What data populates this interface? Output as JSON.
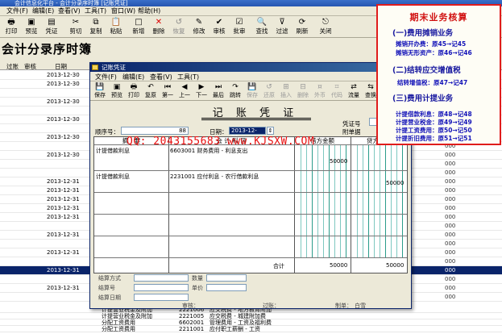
{
  "main": {
    "title": "会计信息化平台 - 会计分录序时簿 [记账凭证]",
    "menu": [
      "文件(F)",
      "编辑(E)",
      "查看(V)",
      "工具(T)",
      "窗口(W)",
      "帮助(H)"
    ],
    "toolbar": [
      "打印",
      "预览",
      "凭证",
      "剪切",
      "复制",
      "粘贴",
      "新增",
      "删除",
      "恢复",
      "修改",
      "审核",
      "批审",
      "查找",
      "过滤",
      "刷新",
      "关闭"
    ],
    "heading": "会计分录序时簿",
    "grid_headers": [
      "过账",
      "审核",
      "日期"
    ],
    "rows": [
      {
        "date": "2013-12-30",
        "amt": "000"
      },
      {
        "date": "2013-12-30",
        "amt": "000"
      },
      {
        "date": "",
        "amt": "000"
      },
      {
        "date": "2013-12-30",
        "amt": "000"
      },
      {
        "date": "",
        "amt": "000"
      },
      {
        "date": "2013-12-30",
        "amt": "000"
      },
      {
        "date": "",
        "amt": "000"
      },
      {
        "date": "2013-12-30",
        "amt": "000"
      },
      {
        "date": "",
        "amt": "000"
      },
      {
        "date": "2013-12-30",
        "amt": "000"
      },
      {
        "date": "",
        "amt": "000"
      },
      {
        "date": "",
        "amt": "000"
      },
      {
        "date": "2013-12-31",
        "amt": "000"
      },
      {
        "date": "2013-12-31",
        "amt": "000"
      },
      {
        "date": "2013-12-31",
        "amt": "000"
      },
      {
        "date": "2013-12-31",
        "amt": "000"
      },
      {
        "date": "2013-12-31",
        "amt": "000"
      },
      {
        "date": "",
        "amt": "000"
      },
      {
        "date": "2013-12-31",
        "amt": "000"
      },
      {
        "date": "",
        "amt": "000"
      },
      {
        "date": "2013-12-31",
        "amt": "000"
      },
      {
        "date": "",
        "amt": "000"
      },
      {
        "date": "2013-12-31",
        "amt": "000"
      },
      {
        "date": "",
        "amt": "000"
      },
      {
        "date": "2013-12-31",
        "amt": "000"
      },
      {
        "date": "",
        "amt": "000"
      }
    ],
    "bottom_rows": [
      {
        "desc": "计提营业税金及附加",
        "code": "2221006",
        "acct": "应交税费 - 地方教育附加"
      },
      {
        "desc": "计提营业税金及附加",
        "code": "2221005",
        "acct": "应交税费 - 城建附加费"
      },
      {
        "desc": "分配工资费用",
        "code": "6602001",
        "acct": "管理费用 - 工资及福利费"
      },
      {
        "desc": "分配工资费用",
        "code": "2211001",
        "acct": "应付职工薪酬 - 工资"
      }
    ]
  },
  "dialog": {
    "title": "记账凭证",
    "menu": [
      "文件(F)",
      "编辑(E)",
      "查看(V)",
      "工具(T)"
    ],
    "toolbar": [
      {
        "label": "保存",
        "icon": "floppy",
        "disabled": false
      },
      {
        "label": "预览",
        "icon": "preview",
        "disabled": false
      },
      {
        "label": "打印",
        "icon": "printer",
        "disabled": false
      },
      {
        "label": "复原",
        "icon": "undo",
        "disabled": false
      },
      {
        "label": "第一",
        "icon": "first",
        "disabled": false
      },
      {
        "label": "上一",
        "icon": "prev",
        "disabled": false
      },
      {
        "label": "下一",
        "icon": "next",
        "disabled": false
      },
      {
        "label": "最后",
        "icon": "last",
        "disabled": false
      },
      {
        "label": "跳转",
        "icon": "jump",
        "disabled": false
      },
      {
        "label": "保存",
        "icon": "save2",
        "disabled": true
      },
      {
        "label": "还原",
        "icon": "restore",
        "disabled": true
      },
      {
        "label": "插入",
        "icon": "insert",
        "disabled": true
      },
      {
        "label": "删除",
        "icon": "delete",
        "disabled": true
      },
      {
        "label": "外币",
        "icon": "currency",
        "disabled": true
      },
      {
        "label": "代码",
        "icon": "code",
        "disabled": true
      },
      {
        "label": "流量",
        "icon": "flow",
        "disabled": false
      },
      {
        "label": "查换",
        "icon": "swap",
        "disabled": false
      },
      {
        "label": "计算器",
        "icon": "calculator",
        "disabled": false
      }
    ],
    "voucher_title": "记 账 凭 证",
    "seq_label": "顺序号：",
    "seq_value": "88",
    "date_label": "日期：",
    "date_value": "2013-12-31",
    "voucher_no_label": "凭证号",
    "attach_label": "附单据",
    "col_summary": "摘　要",
    "col_account": "会 计 科 目",
    "col_debit": "借方金额",
    "col_credit": "贷方金额",
    "lines": [
      {
        "summary": "计提借款利息",
        "account": "6603001 财务费用 - 利息支出",
        "debit": "50000",
        "credit": ""
      },
      {
        "summary": "计提借款利息",
        "account": "2231001 应付利息 - 农行借款利息",
        "debit": "",
        "credit": "50000"
      }
    ],
    "total_label": "合计",
    "total_debit": "50000",
    "total_credit": "50000",
    "watermark": "QQ: 2043155683  www.KJSXW.COM",
    "footer": {
      "settle_label": "结算方式",
      "settle_no_label": "结算号",
      "settle_date_label": "结算日期",
      "qty_label": "数量",
      "price_label": "单价",
      "audit_label": "审核：",
      "post_label": "过账：",
      "maker_label": "制单：",
      "maker_value": "白雪"
    }
  },
  "infobox": {
    "title": "期末业务核算",
    "sections": [
      {
        "heading": "(一)费用摊销业务",
        "items": [
          "摊销开办费：原45→记45",
          "摊销无形资产：原46→记46"
        ]
      },
      {
        "heading": "(二)结转应交增值税",
        "items": [
          "结转增值税：原47→记47"
        ]
      },
      {
        "heading": "(三)费用计提业务",
        "items": [
          "计提借款利息：原48→记48",
          "计提营业税金：原49→记49",
          "计提工资费用：原50→记50",
          "计提折旧费用：原51→记51"
        ]
      }
    ]
  }
}
